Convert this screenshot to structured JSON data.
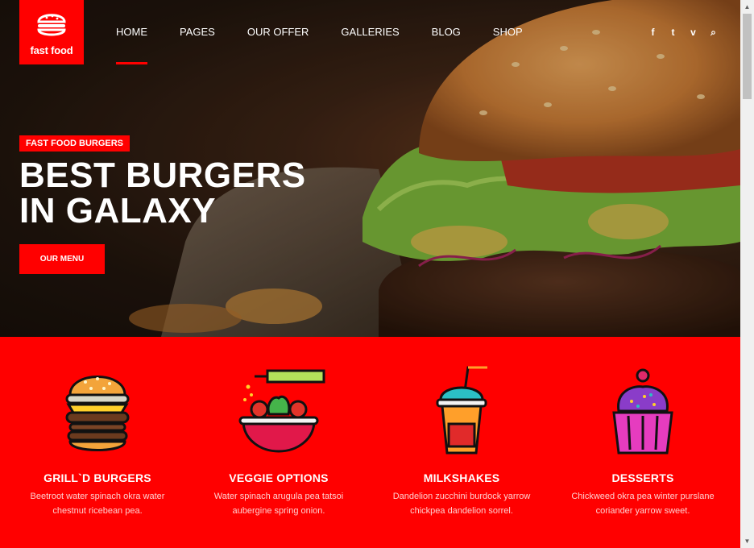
{
  "logo": {
    "text": "fast food"
  },
  "nav": {
    "items": [
      "HOME",
      "PAGES",
      "OUR OFFER",
      "GALLERIES",
      "BLOG",
      "SHOP"
    ],
    "active": "HOME"
  },
  "social": {
    "icons": [
      "facebook-icon",
      "twitter-icon",
      "vine-icon",
      "search-icon"
    ],
    "glyphs": [
      "f",
      "t",
      "v",
      "⌕"
    ]
  },
  "hero": {
    "tag": "FAST FOOD BURGERS",
    "headline_line1": "BEST BURGERS",
    "headline_line2": "IN GALAXY",
    "cta": "OUR MENU"
  },
  "features": [
    {
      "title": "GRILL`D BURGERS",
      "desc": "Beetroot water spinach okra water chestnut ricebean pea.",
      "icon": "burger-icon"
    },
    {
      "title": "VEGGIE OPTIONS",
      "desc": "Water spinach arugula pea tatsoi aubergine spring onion.",
      "icon": "salad-bowl-icon"
    },
    {
      "title": "MILKSHAKES",
      "desc": "Dandelion zucchini burdock yarrow chickpea dandelion sorrel.",
      "icon": "milkshake-icon"
    },
    {
      "title": "DESSERTS",
      "desc": "Chickweed okra pea winter purslane coriander yarrow sweet.",
      "icon": "cupcake-icon"
    }
  ],
  "colors": {
    "accent": "#ff0000",
    "dark": "#1e130c"
  }
}
